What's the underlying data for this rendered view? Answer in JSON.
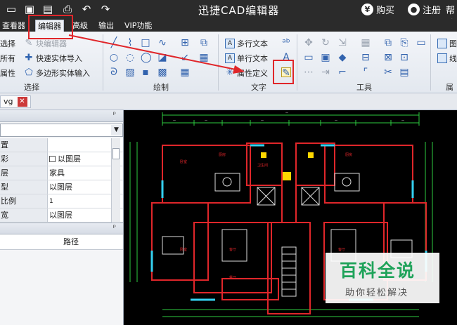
{
  "app": {
    "title": "迅捷CAD编辑器",
    "buy_label": "购买",
    "register_label": "注册",
    "help_label": "帮助"
  },
  "quick_access": [
    "open-icon",
    "save-icon",
    "save-as-icon",
    "print-icon",
    "undo-icon",
    "redo-icon"
  ],
  "menu_tabs": [
    "查看器",
    "编辑器",
    "高级",
    "输出",
    "VIP功能"
  ],
  "ribbon": {
    "select_group": {
      "label": "选择",
      "items": [
        "选择",
        "所有",
        "属性"
      ],
      "block_editor": "块编辑器",
      "quick_entity_import": "快速实体导入",
      "polygon_entity_input": "多边形实体输入"
    },
    "draw_group": {
      "label": "绘制"
    },
    "text_group": {
      "label": "文字",
      "multiline_text": "多行文本",
      "single_line_text": "单行文本",
      "attribute_definition": "属性定义"
    },
    "tools_group": {
      "label": "工具"
    },
    "properties_group": {
      "label": "属性",
      "items": [
        "图",
        "线"
      ]
    }
  },
  "doc_tab": {
    "name": "vg"
  },
  "properties_panel": {
    "rows": [
      {
        "key": "置",
        "value": ""
      },
      {
        "key": "彩",
        "value": "以图层"
      },
      {
        "key": "层",
        "value": "家具"
      },
      {
        "key": "型",
        "value": "以图层"
      },
      {
        "key": "比例",
        "value": "1"
      },
      {
        "key": "宽",
        "value": "以图层"
      }
    ]
  },
  "path_panel": {
    "header": "路径"
  },
  "drawing": {
    "rooms": [
      "厨房",
      "卧室",
      "客厅",
      "餐厅",
      "卫生间",
      "厨房",
      "卧室",
      "客厅"
    ]
  },
  "watermark": {
    "main": "百科全说",
    "sub": "助你轻松解决"
  },
  "colors": {
    "titlebar": "#2b2b2b",
    "highlight": "#e0262a",
    "wall": "#e0262a",
    "accent": "#1fa35a"
  }
}
